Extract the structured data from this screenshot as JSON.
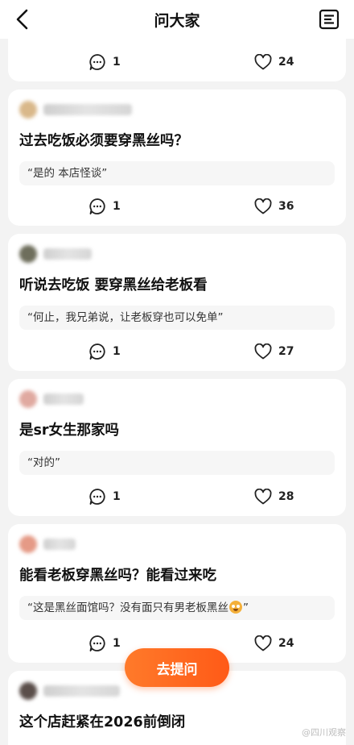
{
  "header": {
    "title": "问大家",
    "back_icon": "chevron-left-icon",
    "menu_icon": "document-list-icon"
  },
  "cards": [
    {
      "partial": true,
      "comments": "1",
      "likes": "24"
    },
    {
      "question": "过去吃饭必须要穿黑丝吗？",
      "answer": "“是的 本店怪谈”",
      "comments": "1",
      "likes": "36"
    },
    {
      "question": "听说去吃饭 要穿黑丝给老板看",
      "answer": "“何止，我兄弟说，让老板穿也可以免单”",
      "comments": "1",
      "likes": "27"
    },
    {
      "question": "是sr女生那家吗",
      "answer": "“对的”",
      "comments": "1",
      "likes": "28"
    },
    {
      "question": "能看老板穿黑丝吗？能看过来吃",
      "answer_before_emoji": "“这是黑丝面馆吗？没有面只有男老板黑丝",
      "answer_after_emoji": "”",
      "comments": "1",
      "likes": "24"
    },
    {
      "question": "这个店赶紧在2026前倒闭"
    }
  ],
  "ask_button": "去提问",
  "watermark": "@四川观察"
}
